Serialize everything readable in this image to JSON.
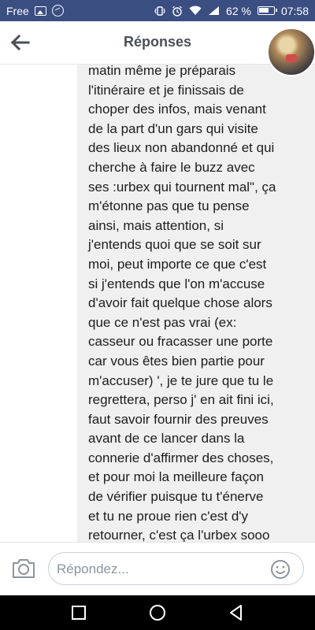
{
  "status_bar": {
    "carrier": "Free",
    "battery_percent": "62 %",
    "time": "07:58",
    "icons": [
      "image-icon",
      "messenger-icon",
      "vibrate-icon",
      "alarm-icon",
      "wifi-icon",
      "signal-icon",
      "battery-icon"
    ]
  },
  "header": {
    "title": "Réponses",
    "back_icon": "arrow-left-icon"
  },
  "message": {
    "text": "matin même je préparais\nl'itinéraire et je finissais de\nchoper des infos, mais venant\nde la part d'un gars qui visite\ndes lieux non abandonné et qui\ncherche à faire le buzz avec\nses :urbex qui tournent mal\", ça\nm'étonne pas que tu pense\nainsi, mais attention, si\nj'entends quoi que se soit sur\nmoi, peut importe ce que c'est\nsi j'entends que l'on m'accuse\nd'avoir fait quelque chose alors\nque ce n'est pas vrai (ex:\ncasseur ou fracasser une porte\ncar vous êtes bien partie pour\nm'accuser) ', je te jure que tu le\nregrettera, perso j' en ait fini ici,\nfaut savoir fournir des preuves\navant de ce lancer dans la\nconnerie d'affirmer des choses,\net pour moi la meilleure façon\nde vérifier puisque tu t'énerve\net tu ne proue rien c'est d'y\nretourner, c'est ça l'urbex sooo"
  },
  "composer": {
    "placeholder": "Répondez...",
    "camera_icon": "camera-icon",
    "emoji_icon": "smiley-icon"
  },
  "nav_bar": {
    "icons": [
      "recents-square-icon",
      "home-circle-icon",
      "back-triangle-icon"
    ]
  },
  "colors": {
    "status_bar": "#3b4e82",
    "bubble": "#f1f0f0",
    "title": "#4b4f56",
    "placeholder": "#8d949e",
    "nav_bar": "#000000"
  }
}
